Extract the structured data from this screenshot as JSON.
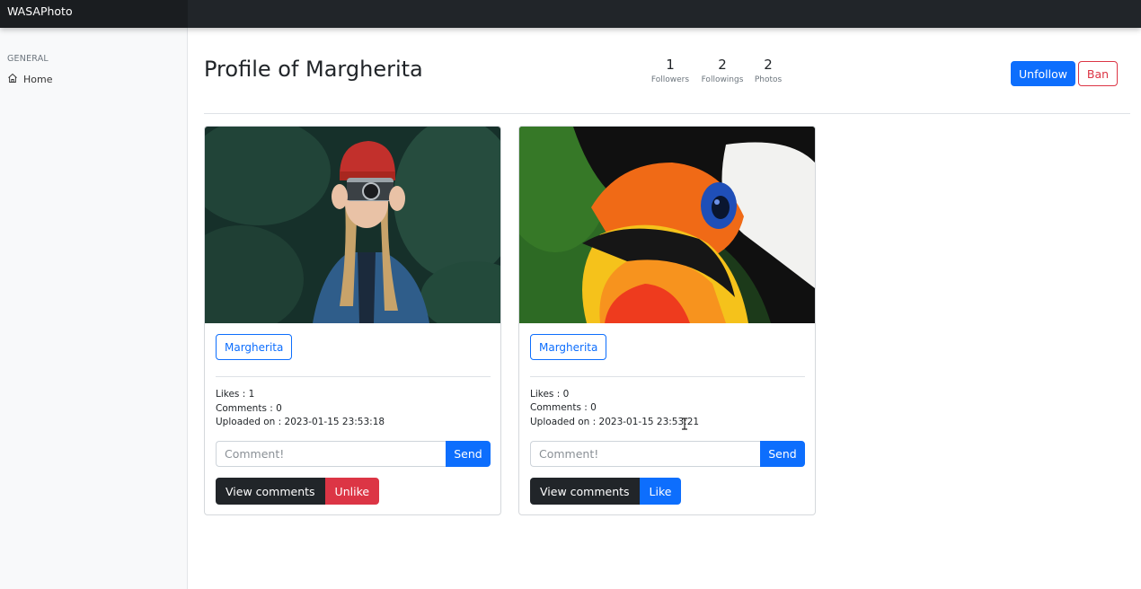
{
  "app": {
    "title": "WASAPhoto"
  },
  "sidebar": {
    "heading": "GENERAL",
    "items": [
      {
        "label": "Home",
        "icon": "home-icon"
      }
    ]
  },
  "profile": {
    "title": "Profile of Margherita",
    "stats": [
      {
        "value": "1",
        "label": "Followers"
      },
      {
        "value": "2",
        "label": "Followings"
      },
      {
        "value": "2",
        "label": "Photos"
      }
    ],
    "unfollow_label": "Unfollow",
    "ban_label": "Ban"
  },
  "photos": [
    {
      "owner": "Margherita",
      "likes": "Likes : 1",
      "comments": "Comments : 0",
      "uploaded": "Uploaded on : 2023-01-15 23:53:18",
      "comment_placeholder": "Comment!",
      "send_label": "Send",
      "view_comments_label": "View comments",
      "like_label": "Unlike",
      "liked": true
    },
    {
      "owner": "Margherita",
      "likes": "Likes : 0",
      "comments": "Comments : 0",
      "uploaded": "Uploaded on : 2023-01-15 23:53:21",
      "comment_placeholder": "Comment!",
      "send_label": "Send",
      "view_comments_label": "View comments",
      "like_label": "Like",
      "liked": false
    }
  ],
  "colors": {
    "primary": "#0d6efd",
    "danger": "#dc3545",
    "dark": "#212529",
    "navbar": "#212529",
    "sidebar_bg": "#f8f9fa"
  }
}
